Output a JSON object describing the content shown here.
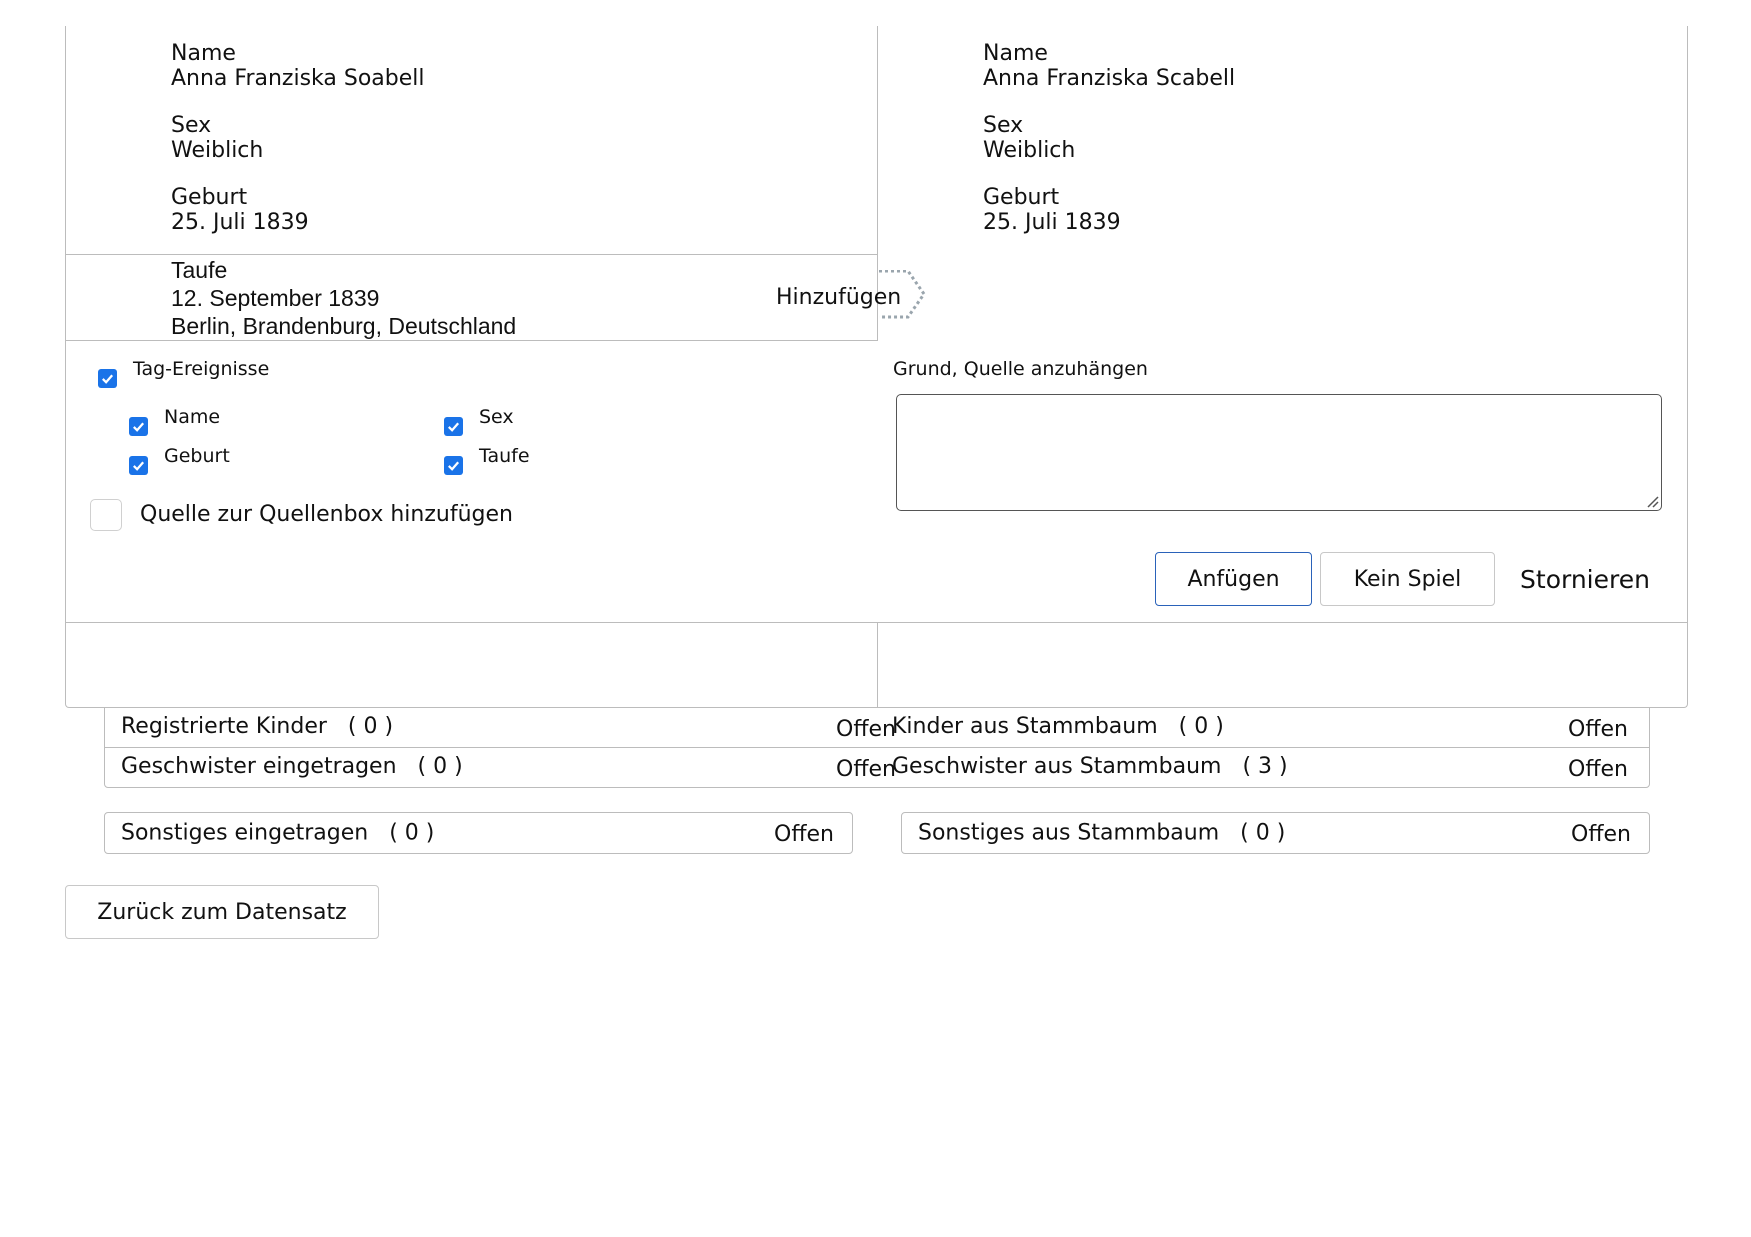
{
  "left_record": {
    "name_label": "Name",
    "name_value": "Anna Franziska Soabell",
    "sex_label": "Sex",
    "sex_value": "Weiblich",
    "birth_label": "Geburt",
    "birth_value": "25. Juli 1839"
  },
  "right_record": {
    "name_label": "Name",
    "name_value": "Anna Franziska Scabell",
    "sex_label": "Sex",
    "sex_value": "Weiblich",
    "birth_label": "Geburt",
    "birth_value": "25. Juli 1839"
  },
  "baptism": {
    "label": "Taufe",
    "date": "12. September 1839",
    "place": "Berlin, Brandenburg, Deutschland",
    "add_label": "Hinzufügen"
  },
  "tag_events": {
    "label": "Tag-Ereignisse",
    "checked": true,
    "items": [
      {
        "label": "Name",
        "checked": true
      },
      {
        "label": "Sex",
        "checked": true
      },
      {
        "label": "Geburt",
        "checked": true
      },
      {
        "label": "Taufe",
        "checked": true
      }
    ]
  },
  "source_box": {
    "label": "Quelle zur Quellenbox hinzufügen",
    "checked": false
  },
  "reason": {
    "label": "Grund, Quelle anzuhängen",
    "value": ""
  },
  "actions": {
    "attach": "Anfügen",
    "no_match": "Kein Spiel",
    "cancel": "Stornieren"
  },
  "sections": {
    "registered_children": "Registrierte Kinder   ( 0 )",
    "tree_children": "Kinder aus Stammbaum   ( 0 )",
    "registered_siblings": "Geschwister eingetragen   ( 0 )",
    "tree_siblings": "Geschwister aus Stammbaum   ( 3 )",
    "registered_other": "Sonstiges eingetragen   ( 0 )",
    "tree_other": "Sonstiges aus Stammbaum   ( 0 )",
    "open_label": "Offen"
  },
  "back_button": "Zurück zum Datensatz",
  "colors": {
    "accent": "#1a73e8",
    "primary_border": "#2a62b9",
    "border": "#bcbcbc"
  }
}
